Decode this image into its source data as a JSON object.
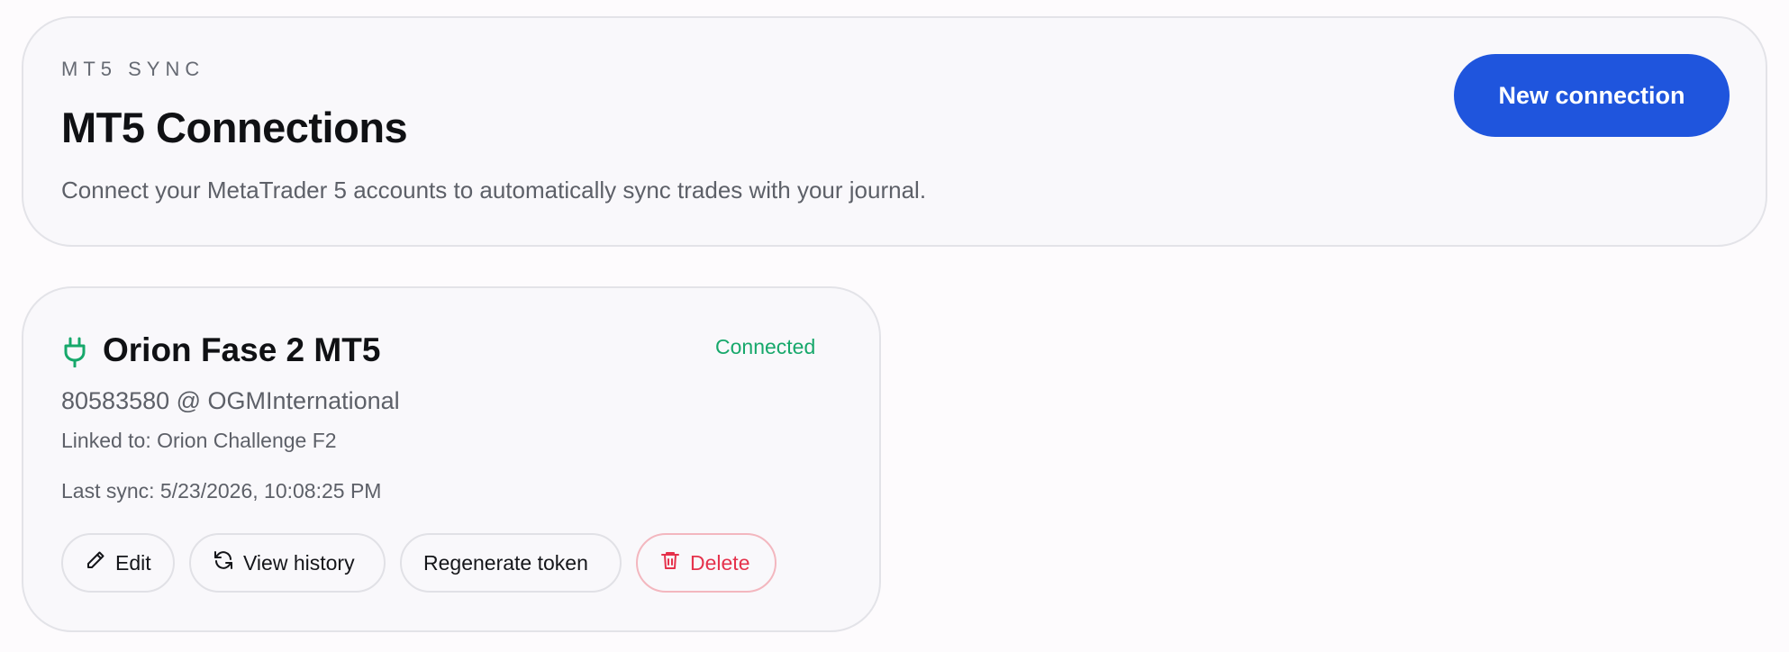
{
  "header": {
    "eyebrow": "MT5 SYNC",
    "title": "MT5 Connections",
    "subtitle": "Connect your MetaTrader 5 accounts to automatically sync trades with your journal.",
    "new_connection_label": "New connection"
  },
  "connection": {
    "name": "Orion Fase 2 MT5",
    "status": "Connected",
    "account": "80583580 @ OGMInternational",
    "linked": "Linked to: Orion Challenge F2",
    "last_sync": "Last sync: 5/23/2026, 10:08:25 PM",
    "actions": {
      "edit": "Edit",
      "view_history": "View history",
      "regenerate_token": "Regenerate token",
      "delete": "Delete"
    }
  },
  "colors": {
    "primary": "#1f55dd",
    "connected": "#17a86b",
    "danger": "#e5324c"
  },
  "icons": {
    "connection": "plug-icon",
    "edit": "pencil-icon",
    "history": "refresh-icon",
    "delete": "trash-icon"
  }
}
